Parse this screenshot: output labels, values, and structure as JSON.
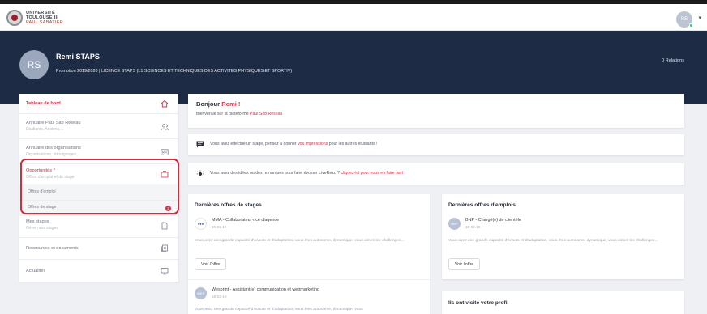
{
  "logo": {
    "line1": "UNIVERSITÉ",
    "line2": "TOULOUSE III",
    "line3": "PAUL SABATIER"
  },
  "user": {
    "initials": "RS",
    "name": "Remi STAPS",
    "promotion": "Promotion 2019/2020 | LICENCE STAPS (L1 SCIENCES ET TECHNIQUES DES ACTIVITES PHYSIQUES ET SPORTIV)",
    "relations": "0 Relations"
  },
  "sidebar": {
    "items": [
      {
        "title": "Tableau de bord",
        "subtitle": "",
        "icon": "home-icon"
      },
      {
        "title": "Annuaire Paul Sab Réseau",
        "subtitle": "Étudiants, Anciens,...",
        "icon": "users-icon"
      },
      {
        "title": "Annuaire des organisations",
        "subtitle": "Organisations, témoignages,...",
        "icon": "id-card-icon"
      },
      {
        "title": "Opportunités ^",
        "subtitle": "Offres d'emploi et de stage",
        "icon": "briefcase-icon"
      },
      {
        "title": "Mes stages",
        "subtitle": "Gérer mes stages",
        "icon": "document-icon"
      },
      {
        "title": "Ressources et documents",
        "subtitle": "",
        "icon": "files-icon"
      },
      {
        "title": "Actualités",
        "subtitle": "",
        "icon": "monitor-icon"
      }
    ],
    "submenu": [
      "Offres d'emploi",
      "Offres de stage"
    ],
    "badge": "3"
  },
  "welcome": {
    "greeting": "Bonjour",
    "name": "Remi !",
    "text_prefix": "Bienvenue sur la plateforme",
    "platform": "Paul Sab Réseau"
  },
  "notices": [
    {
      "prefix": "Vous avez effectué un stage, pensez à donner",
      "link": "vos impressions",
      "suffix": "pour les autres étudiants !"
    },
    {
      "prefix": "Vous avez des idées ou des remarques pour faire évoluer LiveRezo ?",
      "link": "cliquez-ici pour nous en faire part",
      "suffix": ""
    }
  ],
  "stages": {
    "title": "Dernières offres de stages",
    "offers": [
      {
        "logo": "MMA",
        "title": "MMA - Collaborateur·rice d'agence",
        "date": "15-02-19",
        "desc": "Vous avez une grande capacité d'écoute et d'adaptation, vous êtes autonome, dynamique, vous aimez les challenges...",
        "button": "Voir l'offre"
      },
      {
        "logo": "WES",
        "title": "Wesprint - Assistant(e) communication et webmarketing",
        "date": "15-02-19",
        "desc": "Vous avez une grande capacité d'écoute et d'adaptation, vous êtes autonome, dynamique, vous"
      }
    ]
  },
  "emplois": {
    "title": "Dernières offres d'emplois",
    "offers": [
      {
        "logo": "BNP",
        "title": "BNP - Chargé(e) de clientèle",
        "date": "15-02-19",
        "desc": "Vous avez une grande capacité d'écoute et d'adaptation, vous êtes autonome, dynamique, vous aimez les challenges...",
        "button": "Voir l'offre"
      }
    ]
  },
  "visits": {
    "title": "Ils ont visité votre profil"
  },
  "colors": {
    "accent": "#d0344a",
    "banner": "#1d2b45",
    "highlight": "#d62b3a"
  }
}
